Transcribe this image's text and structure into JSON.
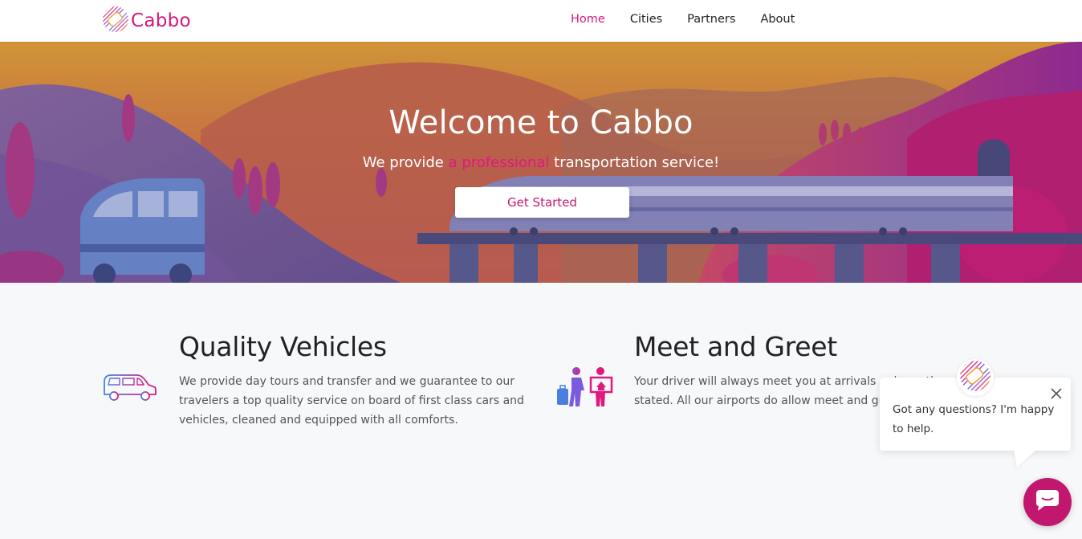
{
  "brand": {
    "name": "Cabbo",
    "accent": "#d6177a",
    "logo_icon": "striped-cab-logo-icon"
  },
  "nav": {
    "items": [
      {
        "label": "Home",
        "active": true
      },
      {
        "label": "Cities",
        "active": false
      },
      {
        "label": "Partners",
        "active": false
      },
      {
        "label": "About",
        "active": false
      }
    ]
  },
  "hero": {
    "title": "Welcome to Cabbo",
    "subtitle_before": "We provide ",
    "subtitle_highlight": "a professional",
    "subtitle_after": " transportation service!",
    "cta_label": "Get Started"
  },
  "features": [
    {
      "title": "Quality Vehicles",
      "text": "We provide day tours and transfer and we guarantee to our travelers a top quality service on board of first class cars and vehicles, cleaned and equipped with all comforts.",
      "icon": "van-icon"
    },
    {
      "title": "Meet and Greet",
      "text": "Your driver will always meet you at arrivals unless otherwise stated. All our airports do allow meet and greet.",
      "icon": "travelers-greeting-icon"
    }
  ],
  "chat": {
    "message": "Got any questions? I'm happy to help.",
    "close_icon": "close-icon",
    "launcher_icon": "chat-bubble-icon",
    "launcher_color": "#c2176f"
  }
}
